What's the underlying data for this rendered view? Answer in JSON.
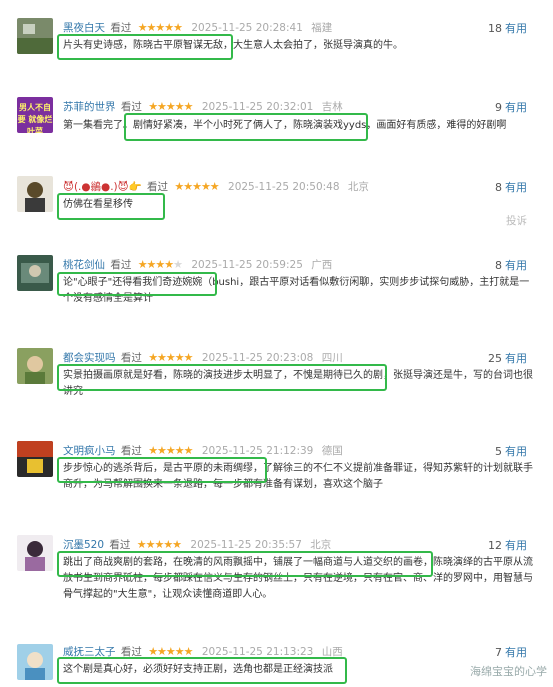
{
  "reviews": [
    {
      "user": "黑夜白天",
      "seen": "看过",
      "stars": 5,
      "time": "2025-11-25 20:28:41",
      "loc": "福建",
      "useful_count": "18",
      "useful_label": "有用",
      "text": "片头有史诗感，陈晓古平原智谋无敌，大生意人太会拍了，张挺导演真的牛。"
    },
    {
      "user": "苏菲的世界",
      "seen": "看过",
      "stars": 5,
      "time": "2025-11-25 20:32:01",
      "loc": "吉林",
      "useful_count": "9",
      "useful_label": "有用",
      "text": "第一集看完了。剧情好紧凑，半个小时死了俩人了，陈晓演装戏yyds，画面好有质感，难得的好剧啊",
      "avatar_text": "男人不自要 就像烂叶菜"
    },
    {
      "user": "😈(.●鶲●.)😈👉",
      "seen": "看过",
      "stars": 5,
      "time": "2025-11-25 20:50:48",
      "loc": "北京",
      "useful_count": "8",
      "useful_label": "有用",
      "text": "仿佛在看星移传",
      "report": "投诉"
    },
    {
      "user": "桃花剑仙",
      "seen": "看过",
      "stars": 4,
      "time": "2025-11-25 20:59:25",
      "loc": "广西",
      "useful_count": "8",
      "useful_label": "有用",
      "text": "论\"心眼子\"还得看我们奇迹婉婉（bushi，跟古平原对话看似敷衍闲聊，实则步步试探句威胁，主打就是一个没有感情全是算计"
    },
    {
      "user": "都会实现吗",
      "seen": "看过",
      "stars": 5,
      "time": "2025-11-25 20:23:08",
      "loc": "四川",
      "useful_count": "25",
      "useful_label": "有用",
      "text": "实景拍摄画原就是好看，陈晓的演技进步太明显了，不愧是期待已久的剧，张挺导演还是牛，写的台词也很讲究"
    },
    {
      "user": "文明疯小马",
      "seen": "看过",
      "stars": 5,
      "time": "2025-11-25 21:12:39",
      "loc": "德国",
      "useful_count": "5",
      "useful_label": "有用",
      "text": "步步惊心的逃杀背后，是古平原的未雨绸缪，了解徐三的不仁不义提前准备罪证，得知苏紫轩的计划就联手商升，为马帮解围换来一条退路，每一步都有准备有谋划，喜欢这个脑子"
    },
    {
      "user": "沉墨520",
      "seen": "看过",
      "stars": 5,
      "time": "2025-11-25 20:35:57",
      "loc": "北京",
      "useful_count": "12",
      "useful_label": "有用",
      "text": "跳出了商战爽剧的套路，在晚清的风雨飘摇中，铺展了一幅商道与人道交织的画卷，陈晓演绎的古平原从流放书生到商界砥柱，每步都踩在信义与生存的钢丝上，只有在逆境，只有在官、商、洋的罗网中，用智慧与骨气撑起的\"大生意\"，让观众读懂商道即人心。"
    },
    {
      "user": "威抚三太子",
      "seen": "看过",
      "stars": 5,
      "time": "2025-11-25 21:13:23",
      "loc": "山西",
      "useful_count": "7",
      "useful_label": "有用",
      "text": "这个剧是真心好，必须好好支持正剧，选角也都是正经演技派"
    }
  ],
  "watermark": "海绵宝宝的心学",
  "colors": {
    "highlight": "#33b94a",
    "link": "#3377aa",
    "star": "#f5a623"
  }
}
